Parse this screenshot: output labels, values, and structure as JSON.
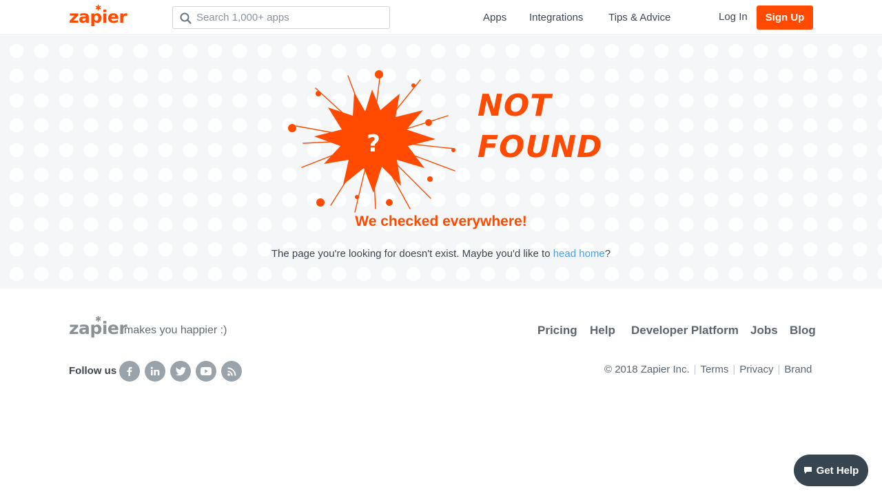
{
  "brand": {
    "logo": "zapier",
    "accent": "#ff4a00"
  },
  "header": {
    "search_placeholder": "Search 1,000+ apps",
    "nav": [
      "Apps",
      "Integrations",
      "Tips & Advice"
    ],
    "login": "Log In",
    "signup": "Sign Up"
  },
  "hero": {
    "illustration_mark": "?",
    "heading_line1": "NOT",
    "heading_line2": "FOUND",
    "subheading": "We checked everywhere!",
    "message_before": "The page you're looking for doesn't exist. Maybe you'd like to ",
    "message_link": "head home",
    "message_after": "?"
  },
  "footer": {
    "logo": "zapier",
    "tagline": "makes you happier :)",
    "links": [
      "Pricing",
      "Help",
      "Developer Platform",
      "Jobs",
      "Blog"
    ],
    "follow_label": "Follow us",
    "social": [
      "facebook-icon",
      "linkedin-icon",
      "twitter-icon",
      "youtube-icon",
      "rss-icon"
    ],
    "copyright": "© 2018 Zapier Inc.",
    "legal": [
      "Terms",
      "Privacy",
      "Brand"
    ]
  },
  "widget": {
    "get_help": "Get Help"
  }
}
